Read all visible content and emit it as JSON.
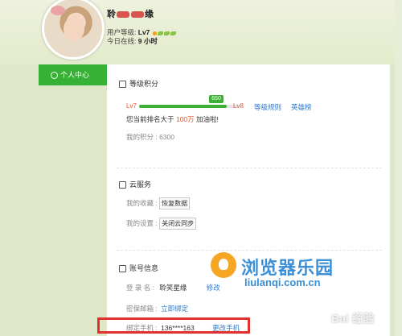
{
  "profile": {
    "name_part1": "聆",
    "name_part2": "缘",
    "level_label": "用户等级:",
    "level_value": "Lv7",
    "online_label": "今日在线:",
    "online_value": "9 小时"
  },
  "nav": {
    "personal_center": "个人中心"
  },
  "level_section": {
    "title": "等级积分",
    "current_level": "Lv7",
    "next_level": "Lv8",
    "badge": "650",
    "progress_fraction": 0.88,
    "rules_link": "等级规则",
    "heroes_link": "英雄榜",
    "rank_prefix": "您当前排名大于",
    "rank_value": "100万",
    "rank_suffix": "加油啦!",
    "points": "我的积分 : 6300"
  },
  "cloud_section": {
    "title": "云服务",
    "favorites_label": "我的收藏 :",
    "restore_button": "恢复数据",
    "settings_label": "我的设置 :",
    "sync_button": "关闭云同步"
  },
  "account_section": {
    "title": "账号信息",
    "login_label": "登 录 名 :",
    "login_value": "聆笑星缘",
    "login_link": "修改",
    "email_label": "密保邮箱 :",
    "email_link": "立即绑定",
    "phone_label": "绑定手机 :",
    "phone_value": "136****163",
    "phone_link": "更改手机"
  },
  "watermark": {
    "cn": "浏览器乐园",
    "en": "liulanqi.com.cn",
    "baidu": "Bai 经验"
  },
  "colors": {
    "accent_green": "#36b035",
    "link_blue": "#2d7bd1",
    "highlight_red": "#e23030",
    "orange": "#e8572c"
  }
}
